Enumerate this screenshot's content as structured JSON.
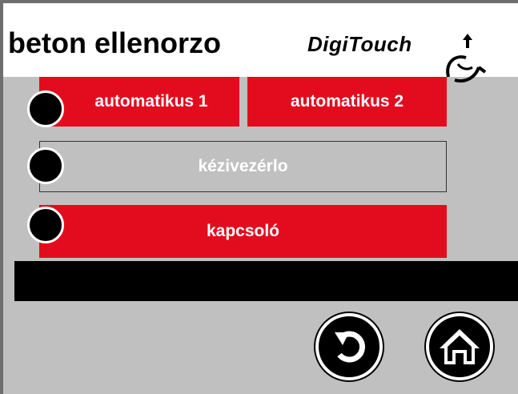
{
  "header": {
    "title": "beton ellenorzo",
    "logo_text": "DigiTouch"
  },
  "buttons": {
    "auto1": "automatikus 1",
    "auto2": "automatikus 2",
    "manual": "kézivezérlo",
    "switch": "kapcsoló"
  },
  "icons": {
    "back": "back-arrow-icon",
    "home": "home-icon"
  },
  "colors": {
    "active_button": "#e30c1e",
    "inactive_button": "#c0c0c0",
    "background": "#c0c0c0",
    "status_bar": "#000000"
  }
}
